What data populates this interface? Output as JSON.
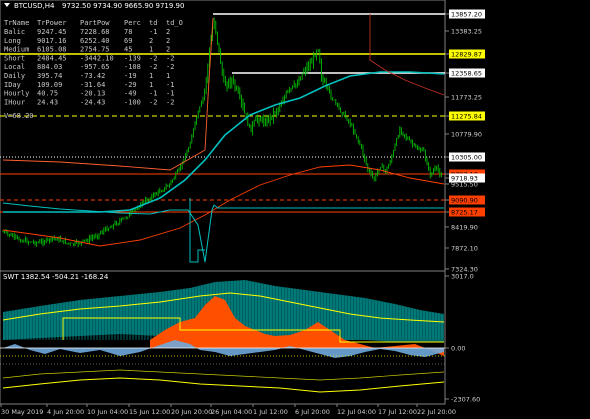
{
  "header": {
    "symbol": "BTCUSD,H4",
    "ohlc": "9732.50 9734.90 9665.90 9719.90"
  },
  "info_table": {
    "columns": [
      "TrName",
      "TrPower",
      "PartPow",
      "Perc",
      "td",
      "td_O"
    ],
    "rows": [
      [
        "Balic",
        "9247.45",
        "7228.68",
        "78",
        "-1",
        "2"
      ],
      [
        "Long",
        "9017.16",
        "6252.40",
        "69",
        "2",
        "2"
      ],
      [
        "Medium",
        "6105.08",
        "2754.75",
        "45",
        "1",
        "2"
      ],
      [
        "Short",
        "2484.45",
        "-3442.10",
        "-139",
        "-2",
        "-2"
      ],
      [
        "Local",
        "884.03",
        "-957.65",
        "-108",
        "-2",
        "-2"
      ],
      [
        "Daily",
        "395.74",
        "-73.42",
        "-19",
        "1",
        "1"
      ],
      [
        "IDay",
        "109.09",
        "-31.64",
        "-29",
        "1",
        "-1"
      ],
      [
        "Hourly",
        "40.75",
        "-20.13",
        "-49",
        "-1",
        "-1"
      ],
      [
        "IHour",
        "24.43",
        "-24.43",
        "-100",
        "-2",
        "-2"
      ]
    ],
    "footer": "V=68.20"
  },
  "price_axis": {
    "ticks": [
      "13857.20",
      "13383.25",
      "12829.87",
      "12358.65",
      "11773.25",
      "11275.84",
      "10779.90",
      "10305.00",
      "9797.10",
      "9718.93",
      "9515.50",
      "9090.90",
      "8725.17",
      "8419.90",
      "7872.10",
      "7324.30"
    ],
    "highlighted": [
      {
        "label": "13857.20",
        "color": "#ffffff"
      },
      {
        "label": "12829.87",
        "color": "#ffff00"
      },
      {
        "label": "12358.65",
        "color": "#ffffff"
      },
      {
        "label": "11275.84",
        "color": "#ffff00"
      },
      {
        "label": "10305.00",
        "color": "#ffffff"
      },
      {
        "label": "9797.10",
        "color": "#ff4000"
      },
      {
        "label": "9718.93",
        "color": "#ffffff"
      },
      {
        "label": "9090.90",
        "color": "#ff4000"
      },
      {
        "label": "8725.17",
        "color": "#ff4000"
      }
    ]
  },
  "indicator": {
    "title": "SWT 1382.54 -504.21 -168.24",
    "ticks": [
      "3017.0",
      "0.00",
      "-2307.60"
    ]
  },
  "time_axis": {
    "labels": [
      "30 May 2019",
      "4 Jun 20:00",
      "10 Jun 04:00",
      "15 Jun 12:00",
      "20 Jun 20:00",
      "26 Jun 04:00",
      "1 Jul 12:00",
      "6 Jul 20:00",
      "12 Jul 04:00",
      "17 Jul 12:00",
      "22 Jul 20:00"
    ]
  },
  "colors": {
    "background": "#000000",
    "candles": "#00c000",
    "ma_fast": "#00c0c0",
    "support": "#ff4000",
    "resistance": "#ffff00",
    "level_white": "#ffffff",
    "histo_pos": "#ff5000",
    "histo_neg": "#6fa8dc",
    "band_fill": "#008080"
  }
}
